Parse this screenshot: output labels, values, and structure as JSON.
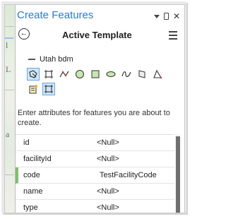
{
  "window": {
    "title": "Create Features"
  },
  "map": {
    "letters": [
      "l",
      "L",
      "a"
    ]
  },
  "header": {
    "back_icon": "back-arrow-icon",
    "title": "Active Template",
    "menu_icon": "hamburger-menu-icon"
  },
  "layer": {
    "name": "Utah bdm"
  },
  "tools": [
    {
      "name": "point-tool-icon",
      "active": true
    },
    {
      "name": "rectangle-select-tool-icon",
      "active": false
    },
    {
      "name": "line-tool-icon",
      "active": false
    },
    {
      "name": "circle-tool-icon",
      "active": false
    },
    {
      "name": "square-tool-icon",
      "active": false
    },
    {
      "name": "ellipse-tool-icon",
      "active": false
    },
    {
      "name": "freehand-tool-icon",
      "active": false
    },
    {
      "name": "polygon-tool-icon",
      "active": false
    },
    {
      "name": "autocomplete-polygon-tool-icon",
      "active": false
    },
    {
      "name": "template-tool-icon",
      "active": false
    },
    {
      "name": "extent-tool-icon",
      "active": true
    }
  ],
  "instruction": "Enter attributes for features you are about to create.",
  "attributes": [
    {
      "name": "id",
      "value": "<Null>"
    },
    {
      "name": "facilityId",
      "value": "<Null>"
    },
    {
      "name": "code",
      "value": "TestFacilityCode"
    },
    {
      "name": "name",
      "value": "<Null>"
    },
    {
      "name": "type",
      "value": "<Null>"
    }
  ],
  "colors": {
    "title": "#2a7bd0",
    "tool_active_bg": "#cfe6fb",
    "tool_active_border": "#6aa7dd",
    "selected_row_marker": "#7fbf6f"
  }
}
